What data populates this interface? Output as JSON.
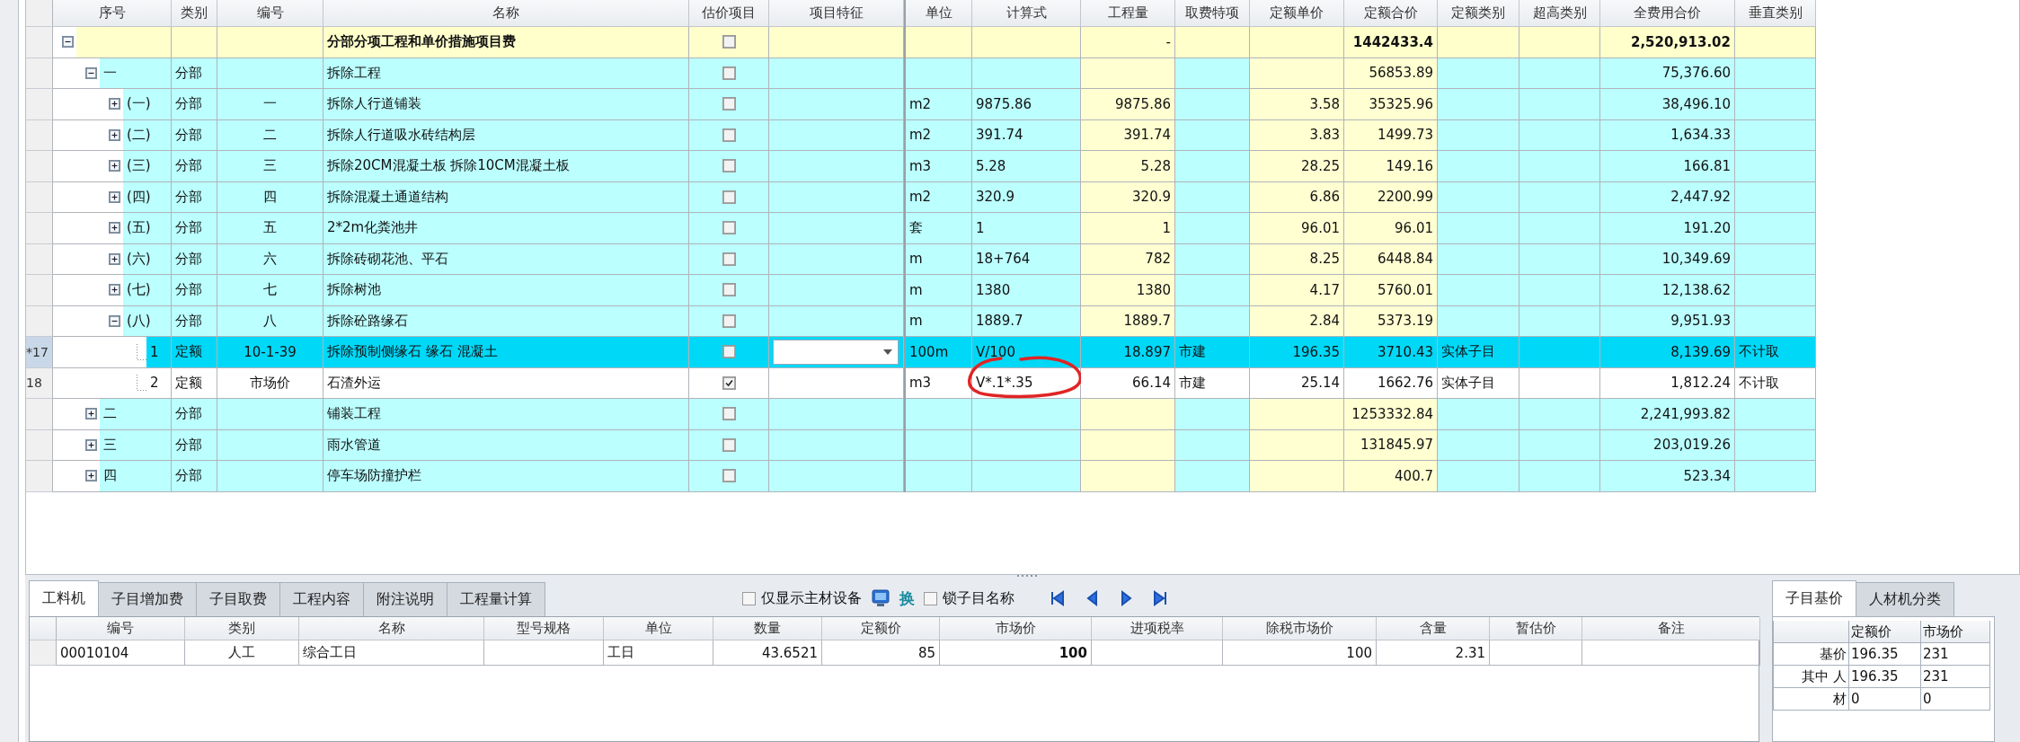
{
  "columns": [
    "序号",
    "类别",
    "编号",
    "名称",
    "估价项目",
    "项目特征",
    "单位",
    "计算式",
    "工程量",
    "取费特项",
    "定额单价",
    "定额合价",
    "定额类别",
    "超高类别",
    "全费用合价",
    "垂直类别"
  ],
  "rows": [
    {
      "kind": "total",
      "expanded": true,
      "selected": false,
      "name": "分部分项工程和单价措施项目费",
      "estimate": false,
      "qty": "-",
      "amount": "1442433.4",
      "full_price": "2,520,913.02",
      "children": [
        {
          "kind": "section",
          "expanded": true,
          "selected": false,
          "seq": "一",
          "type": "分部",
          "name": "拆除工程",
          "estimate": false,
          "amount": "56853.89",
          "full_price": "75,376.60",
          "children": [
            {
              "kind": "subsection",
              "expanded": false,
              "selected": false,
              "seq": "(一)",
              "type": "分部",
              "code": "一",
              "name": "拆除人行道铺装",
              "estimate": false,
              "unit": "m2",
              "formula": "9875.86",
              "qty": "9875.86",
              "unit_price": "3.58",
              "amount": "35325.96",
              "full_price": "38,496.10"
            },
            {
              "kind": "subsection",
              "expanded": false,
              "selected": false,
              "seq": "(二)",
              "type": "分部",
              "code": "二",
              "name": "拆除人行道吸水砖结构层",
              "estimate": false,
              "unit": "m2",
              "formula": "391.74",
              "qty": "391.74",
              "unit_price": "3.83",
              "amount": "1499.73",
              "full_price": "1,634.33"
            },
            {
              "kind": "subsection",
              "expanded": false,
              "selected": false,
              "seq": "(三)",
              "type": "分部",
              "code": "三",
              "name": "拆除20CM混凝土板 拆除10CM混凝土板",
              "estimate": false,
              "unit": "m3",
              "formula": "5.28",
              "qty": "5.28",
              "unit_price": "28.25",
              "amount": "149.16",
              "full_price": "166.81"
            },
            {
              "kind": "subsection",
              "expanded": false,
              "selected": false,
              "seq": "(四)",
              "type": "分部",
              "code": "四",
              "name": "拆除混凝土通道结构",
              "estimate": false,
              "unit": "m2",
              "formula": "320.9",
              "qty": "320.9",
              "unit_price": "6.86",
              "amount": "2200.99",
              "full_price": "2,447.92"
            },
            {
              "kind": "subsection",
              "expanded": false,
              "selected": false,
              "seq": "(五)",
              "type": "分部",
              "code": "五",
              "name": "2*2m化粪池井",
              "estimate": false,
              "unit": "套",
              "formula": "1",
              "qty": "1",
              "unit_price": "96.01",
              "amount": "96.01",
              "full_price": "191.20"
            },
            {
              "kind": "subsection",
              "expanded": false,
              "selected": false,
              "seq": "(六)",
              "type": "分部",
              "code": "六",
              "name": "拆除砖砌花池、平石",
              "estimate": false,
              "unit": "m",
              "formula": "18+764",
              "qty": "782",
              "unit_price": "8.25",
              "amount": "6448.84",
              "full_price": "10,349.69"
            },
            {
              "kind": "subsection",
              "expanded": false,
              "selected": false,
              "seq": "(七)",
              "type": "分部",
              "code": "七",
              "name": "拆除树池",
              "estimate": false,
              "unit": "m",
              "formula": "1380",
              "qty": "1380",
              "unit_price": "4.17",
              "amount": "5760.01",
              "full_price": "12,138.62"
            },
            {
              "kind": "subsection",
              "expanded": true,
              "selected": false,
              "seq": "(八)",
              "type": "分部",
              "code": "八",
              "name": "拆除砼路缘石",
              "estimate": false,
              "unit": "m",
              "formula": "1889.7",
              "qty": "1889.7",
              "unit_price": "2.84",
              "amount": "5373.19",
              "full_price": "9,951.93",
              "children": [
                {
                  "kind": "item",
                  "selected": true,
                  "circled": false,
                  "row_label": "*17",
                  "seq": "1",
                  "type": "定额",
                  "code": "10-1-39",
                  "name": "拆除预制侧缘石 缘石 混凝土",
                  "estimate": false,
                  "unit": "100m",
                  "formula": "V/100",
                  "qty": "18.897",
                  "fee": "市建",
                  "unit_price": "196.35",
                  "amount": "3710.43",
                  "quota_type": "实体子目",
                  "full_price": "8,139.69",
                  "vertical": "不计取"
                },
                {
                  "kind": "item",
                  "selected": false,
                  "circled": true,
                  "row_label": "18",
                  "seq": "2",
                  "type": "定额",
                  "code": "市场价",
                  "name": "石渣外运",
                  "estimate": true,
                  "unit": "m3",
                  "formula": "V*.1*.35",
                  "qty": "66.14",
                  "fee": "市建",
                  "unit_price": "25.14",
                  "amount": "1662.76",
                  "quota_type": "实体子目",
                  "full_price": "1,812.24",
                  "vertical": "不计取"
                }
              ]
            }
          ]
        },
        {
          "kind": "section",
          "expanded": false,
          "selected": false,
          "seq": "二",
          "type": "分部",
          "name": "铺装工程",
          "estimate": false,
          "amount": "1253332.84",
          "full_price": "2,241,993.82"
        },
        {
          "kind": "section",
          "expanded": false,
          "selected": false,
          "seq": "三",
          "type": "分部",
          "name": "雨水管道",
          "estimate": false,
          "amount": "131845.97",
          "full_price": "203,019.26"
        },
        {
          "kind": "section",
          "expanded": false,
          "selected": false,
          "seq": "四",
          "type": "分部",
          "name": "停车场防撞护栏",
          "estimate": false,
          "amount": "400.7",
          "full_price": "523.34"
        }
      ]
    }
  ],
  "bottom_tabs": [
    {
      "label": "工料机",
      "selected": true
    },
    {
      "label": "子目增加费",
      "selected": false
    },
    {
      "label": "子目取费",
      "selected": false
    },
    {
      "label": "工程内容",
      "selected": false
    },
    {
      "label": "附注说明",
      "selected": false
    },
    {
      "label": "工程量计算",
      "selected": false
    }
  ],
  "toolbar": {
    "main_material_only": {
      "label": "仅显示主材设备",
      "checked": false
    },
    "swap_label": "换",
    "lock_name": {
      "label": "锁子目名称",
      "checked": false
    }
  },
  "resource_columns": [
    "编号",
    "类别",
    "名称",
    "型号规格",
    "单位",
    "数量",
    "定额价",
    "市场价",
    "进项税率",
    "除税市场价",
    "含量",
    "暂估价",
    "备注"
  ],
  "resource_rows": [
    {
      "code": "00010104",
      "type": "人工",
      "name": "综合工日",
      "unit": "工日",
      "quantity": "43.6521",
      "quota_price": "85",
      "market_price": "100",
      "net_market_price": "100",
      "content": "2.31"
    }
  ],
  "side_tabs": [
    {
      "label": "子目基价",
      "selected": true
    },
    {
      "label": "人材机分类",
      "selected": false
    }
  ],
  "price_columns": [
    "定额价",
    "市场价"
  ],
  "price_rows": [
    {
      "label": "基价",
      "quota": "196.35",
      "market": "231"
    },
    {
      "label": "其中 人",
      "quota": "196.35",
      "market": "231"
    },
    {
      "label": "材",
      "quota": "0",
      "market": "0"
    }
  ]
}
